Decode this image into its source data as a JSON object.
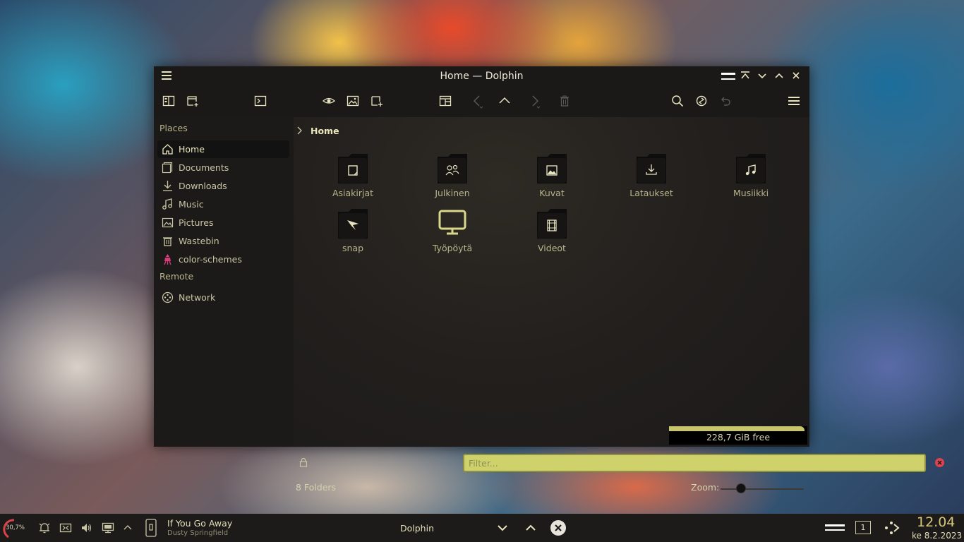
{
  "window": {
    "title": "Home — Dolphin"
  },
  "toolbar": {
    "icons": [
      "split-view-icon",
      "new-tab-icon",
      "terminal-icon",
      "preview-eye-icon",
      "image-icon",
      "new-folder-icon",
      "panels-icon",
      "back-icon",
      "up-icon",
      "forward-icon",
      "delete-icon",
      "search-icon",
      "reload-icon",
      "undo-icon",
      "hamburger-menu-icon"
    ]
  },
  "sidebar": {
    "places_header": "Places",
    "remote_header": "Remote",
    "items": [
      {
        "label": "Home",
        "icon": "home-icon"
      },
      {
        "label": "Documents",
        "icon": "documents-icon"
      },
      {
        "label": "Downloads",
        "icon": "downloads-icon"
      },
      {
        "label": "Music",
        "icon": "music-icon"
      },
      {
        "label": "Pictures",
        "icon": "pictures-icon"
      },
      {
        "label": "Wastebin",
        "icon": "trash-icon"
      },
      {
        "label": "color-schemes",
        "icon": "paint-icon"
      }
    ],
    "remote_items": [
      {
        "label": "Network",
        "icon": "network-icon"
      }
    ]
  },
  "breadcrumb": {
    "current": "Home"
  },
  "files": [
    {
      "name": "Asiakirjat",
      "icon": "document-folder-icon"
    },
    {
      "name": "Julkinen",
      "icon": "public-folder-icon"
    },
    {
      "name": "Kuvat",
      "icon": "pictures-folder-icon"
    },
    {
      "name": "Lataukset",
      "icon": "downloads-folder-icon"
    },
    {
      "name": "Musiikki",
      "icon": "music-folder-icon"
    },
    {
      "name": "snap",
      "icon": "snap-folder-icon"
    },
    {
      "name": "Työpöytä",
      "icon": "desktop-monitor-icon"
    },
    {
      "name": "Videot",
      "icon": "videos-folder-icon"
    }
  ],
  "filter": {
    "placeholder": "Filter..."
  },
  "status": {
    "folders": "8 Folders",
    "zoom_label": "Zoom:",
    "free_space": "228,7 GiB free",
    "free_bar_fill": 0.98
  },
  "taskbar": {
    "cpu": "30,7%",
    "media_title": "If You Go Away",
    "media_artist": "Dusty Springfield",
    "task_name": "Dolphin",
    "desktop_number": "1",
    "clock_time": "12.04",
    "clock_date": "ke 8.2.2023"
  },
  "colors": {
    "accent": "#cfd26a",
    "text": "#c9c6a4",
    "window_bg": "#1f1d1c",
    "close_red": "#e0414f"
  }
}
